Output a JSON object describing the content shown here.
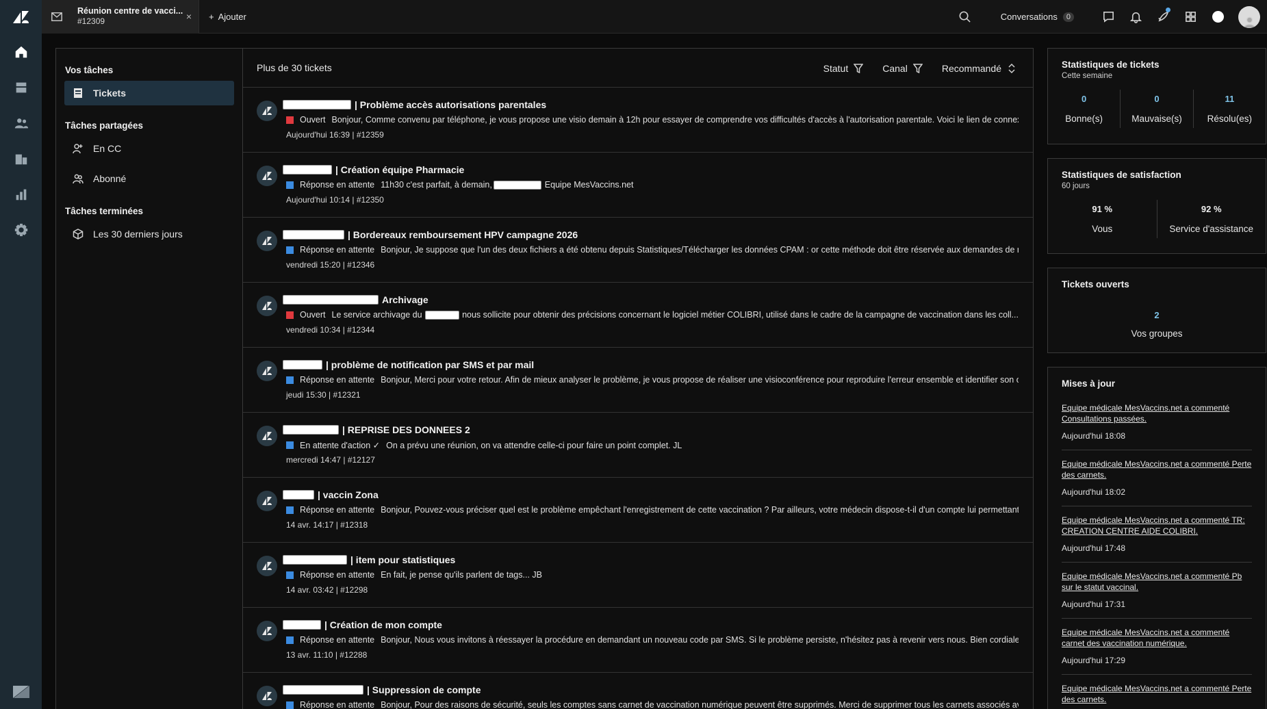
{
  "tab": {
    "title": "Réunion centre de vacci...",
    "number": "#12309"
  },
  "add_tab_label": "Ajouter",
  "conversations": {
    "label": "Conversations",
    "count": "0"
  },
  "left_panel": {
    "your_tasks": "Vos tâches",
    "tickets": "Tickets",
    "shared_tasks": "Tâches partagées",
    "cc": "En CC",
    "subscribed": "Abonné",
    "done_tasks": "Tâches terminées",
    "last_30": "Les 30 derniers jours"
  },
  "list": {
    "count": "Plus de 30 tickets",
    "filter_status": "Statut",
    "filter_channel": "Canal",
    "sort": "Recommandé",
    "tickets": [
      {
        "title": "| Problème accès autorisations parentales",
        "status": "Ouvert",
        "status_color": "#e0393e",
        "excerpt": "Bonjour, Comme convenu par téléphone, je vous propose une visio demain à 12h pour essayer de comprendre vos difficultés d'accès à l'autorisation parentale. Voici le lien de connexion : ht...",
        "meta": "Aujourd'hui 16:39 | #12359"
      },
      {
        "title": "| Création équipe Pharmacie",
        "status": "Réponse en attente",
        "status_color": "#3b8be0",
        "excerpt_a": "11h30 c'est parfait, à demain,",
        "excerpt_b": "Equipe MesVaccins.net",
        "meta": "Aujourd'hui 10:14 | #12350"
      },
      {
        "title": "| Bordereaux remboursement HPV campagne 2026",
        "status": "Réponse en attente",
        "status_color": "#3b8be0",
        "excerpt": "Bonjour, Je suppose que l'un des deux fichiers a été obtenu depuis Statistiques/Télécharger les données CPAM : or cette méthode doit être réservée aux demandes de rembours...",
        "meta": "vendredi 15:20 | #12346"
      },
      {
        "title": "Archivage",
        "status": "Ouvert",
        "status_color": "#e0393e",
        "excerpt_a": "Le service archivage du",
        "excerpt_b": "nous sollicite pour obtenir des précisions concernant le logiciel métier COLIBRI, utilisé dans le cadre de la campagne de vaccination dans les coll...",
        "meta": "vendredi 10:34 | #12344"
      },
      {
        "title": "| problème de notification par SMS et par mail",
        "status": "Réponse en attente",
        "status_color": "#3b8be0",
        "excerpt": "Bonjour, Merci pour votre retour. Afin de mieux analyser le problème, je vous propose de réaliser une visioconférence pour reproduire l'erreur ensemble et identifier son origine...",
        "meta": "jeudi 15:30 | #12321"
      },
      {
        "title": "| REPRISE DES DONNEES 2",
        "status": "En attente d'action ✓",
        "status_color": "#3b8be0",
        "excerpt": "On a prévu une réunion, on va attendre celle-ci pour faire un point complet. JL",
        "meta": "mercredi 14:47 | #12127"
      },
      {
        "title": "| vaccin Zona",
        "status": "Réponse en attente",
        "status_color": "#3b8be0",
        "excerpt": "Bonjour, Pouvez-vous préciser quel est le problème empêchant l'enregistrement de cette vaccination ? Par ailleurs, votre médecin dispose-t-il d'un compte lui permettant d'acc...",
        "meta": "14 avr. 14:17 | #12318"
      },
      {
        "title": "| item pour statistiques",
        "status": "Réponse en attente",
        "status_color": "#3b8be0",
        "excerpt": "En fait, je pense qu'ils parlent de tags... JB",
        "meta": "14 avr. 03:42 | #12298"
      },
      {
        "title": "| Création de mon compte",
        "status": "Réponse en attente",
        "status_color": "#3b8be0",
        "excerpt": "Bonjour, Nous vous invitons à réessayer la procédure en demandant un nouveau code par SMS. Si le problème persiste, n'hésitez pas à revenir vers nous. Bien cordialement, Vla...",
        "meta": "13 avr. 11:10 | #12288"
      },
      {
        "title": "| Suppression de compte",
        "status": "Réponse en attente",
        "status_color": "#3b8be0",
        "excerpt": "Bonjour, Pour des raisons de sécurité, seuls les comptes sans carnet de vaccination numérique peuvent être supprimés. Merci de supprimer tous les carnets associés avant de re...",
        "meta": ""
      }
    ]
  },
  "ticket_stats": {
    "title": "Statistiques de tickets",
    "sub": "Cette semaine",
    "good": {
      "value": "0",
      "label": "Bonne(s)"
    },
    "bad": {
      "value": "0",
      "label": "Mauvaise(s)"
    },
    "resolved": {
      "value": "11",
      "label": "Résolu(es)"
    }
  },
  "satisfaction": {
    "title": "Statistiques de satisfaction",
    "sub": "60 jours",
    "you": {
      "value": "91 %",
      "label": "Vous"
    },
    "support": {
      "value": "92 %",
      "label": "Service d'assistance"
    }
  },
  "open_tickets": {
    "title": "Tickets ouverts",
    "value": "2",
    "label": "Vos groupes"
  },
  "updates": {
    "title": "Mises à jour",
    "items": [
      {
        "text": "Equipe médicale MesVaccins.net a commenté Consultations passées.",
        "time": "Aujourd'hui 18:08"
      },
      {
        "text": "Equipe médicale MesVaccins.net a commenté Perte des carnets.",
        "time": "Aujourd'hui 18:02"
      },
      {
        "text": "Equipe médicale MesVaccins.net a commenté TR: CREATION CENTRE AIDE COLIBRI.",
        "time": "Aujourd'hui 17:48"
      },
      {
        "text": "Equipe médicale MesVaccins.net a commenté Pb sur le statut vaccinal.",
        "time": "Aujourd'hui 17:31"
      },
      {
        "text": "Equipe médicale MesVaccins.net a commenté carnet des vaccination numérique.",
        "time": "Aujourd'hui 17:29"
      },
      {
        "text": "Equipe médicale MesVaccins.net a commenté Perte des carnets.",
        "time": ""
      }
    ]
  },
  "icons": {
    "rail": [
      "zendesk-logo-icon",
      "home-icon",
      "views-icon",
      "customers-icon",
      "organizations-icon",
      "reporting-icon",
      "admin-gear-icon"
    ],
    "topbar": [
      "search-icon",
      "chat-icon",
      "bell-icon",
      "rocket-icon",
      "apps-grid-icon",
      "status-dot-icon",
      "profile-avatar-icon"
    ]
  },
  "colors": {
    "rail_bg": "#1d2a33",
    "accent_blue": "#7fc3e8",
    "open_red": "#e0393e",
    "pending_blue": "#3b8be0"
  }
}
